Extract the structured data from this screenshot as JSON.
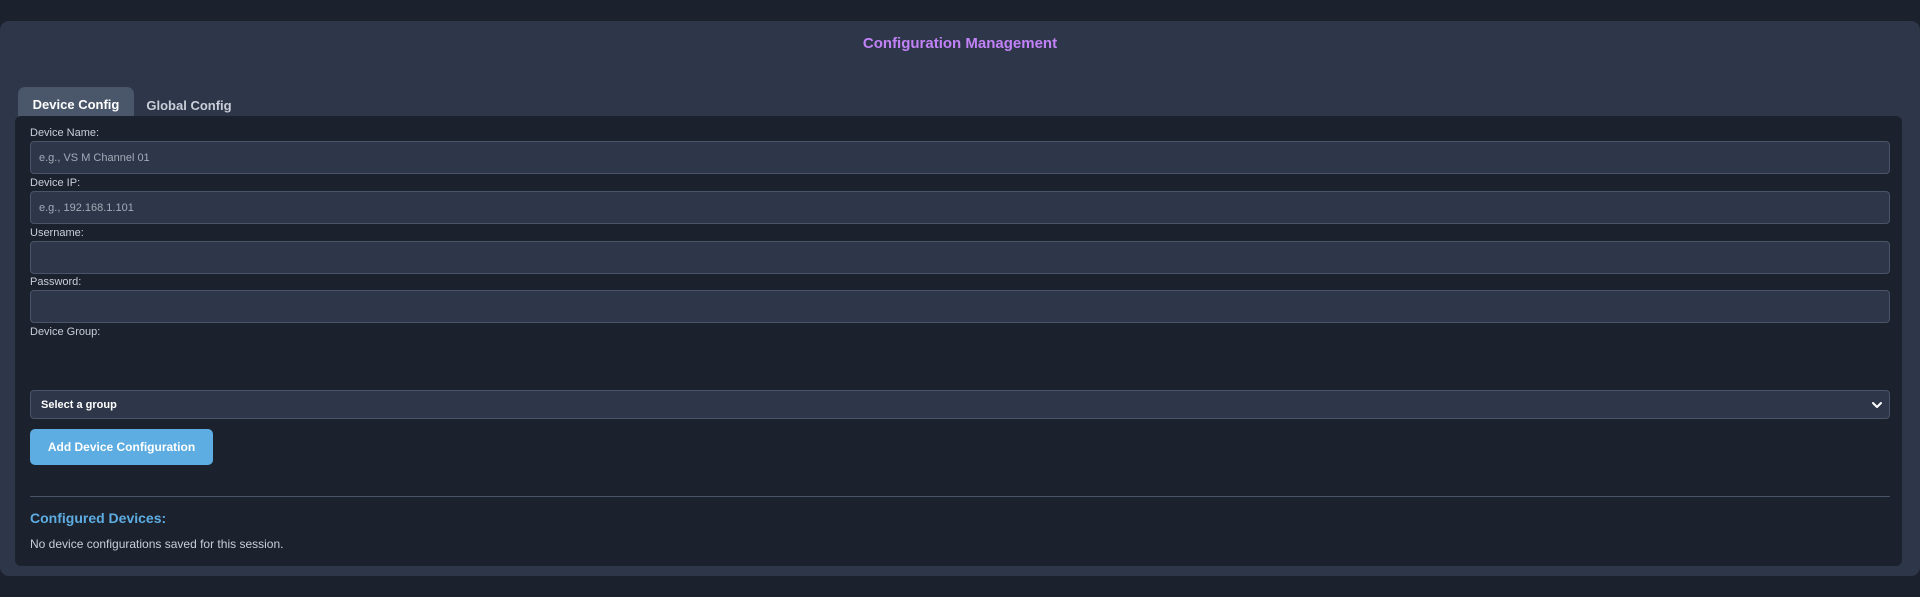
{
  "panel": {
    "title": "Configuration Management"
  },
  "tabs": [
    {
      "label": "Device Config",
      "active": true
    },
    {
      "label": "Global Config",
      "active": false
    }
  ],
  "form": {
    "device_name": {
      "label": "Device Name:",
      "placeholder": "e.g., VS M Channel 01",
      "value": ""
    },
    "device_ip": {
      "label": "Device IP:",
      "placeholder": "e.g., 192.168.1.101",
      "value": ""
    },
    "username": {
      "label": "Username:",
      "placeholder": "",
      "value": ""
    },
    "password": {
      "label": "Password:",
      "placeholder": "",
      "value": ""
    },
    "device_group": {
      "label": "Device Group:",
      "selected": "Select a group"
    },
    "submit_label": "Add Device Configuration"
  },
  "configured": {
    "title": "Configured Devices:",
    "empty_message": "No device configurations saved for this session."
  },
  "colors": {
    "page_background": "#1c222d",
    "panel_background": "#2e3749",
    "title_accent": "#c282f7",
    "primary_accent": "#5dade2"
  },
  "icons": {
    "select_chevron": "chevron-down-icon"
  }
}
